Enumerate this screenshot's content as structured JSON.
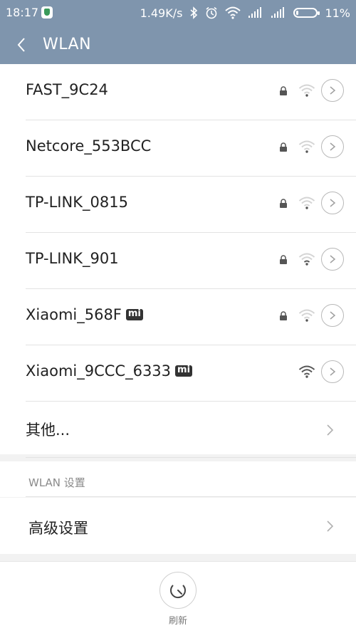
{
  "status_bar": {
    "time": "18:17",
    "speed": "1.49K/s",
    "battery": "11%",
    "icons": [
      "shield-icon",
      "bluetooth-icon",
      "alarm-icon",
      "wifi-icon",
      "signal-icon",
      "signal-icon",
      "battery-icon"
    ]
  },
  "header": {
    "title": "WLAN",
    "back_icon": "back-arrow-icon"
  },
  "networks": [
    {
      "ssid": "FAST_9C24",
      "locked": true,
      "signal": "weak",
      "mi": false
    },
    {
      "ssid": "Netcore_553BCC",
      "locked": true,
      "signal": "weak",
      "mi": false
    },
    {
      "ssid": "TP-LINK_0815",
      "locked": true,
      "signal": "weak",
      "mi": false
    },
    {
      "ssid": "TP-LINK_901",
      "locked": true,
      "signal": "medium",
      "mi": false
    },
    {
      "ssid": "Xiaomi_568F",
      "locked": true,
      "signal": "weak",
      "mi": true
    },
    {
      "ssid": "Xiaomi_9CCC_6333",
      "locked": false,
      "signal": "strong",
      "mi": true
    }
  ],
  "other": {
    "label": "其他..."
  },
  "wlan_settings": {
    "section_title": "WLAN 设置",
    "advanced_label": "高级设置"
  },
  "bottom": {
    "refresh_label": "刷新"
  },
  "colors": {
    "header_bg": "#7f95ad",
    "accent": "#3a9a5a"
  }
}
